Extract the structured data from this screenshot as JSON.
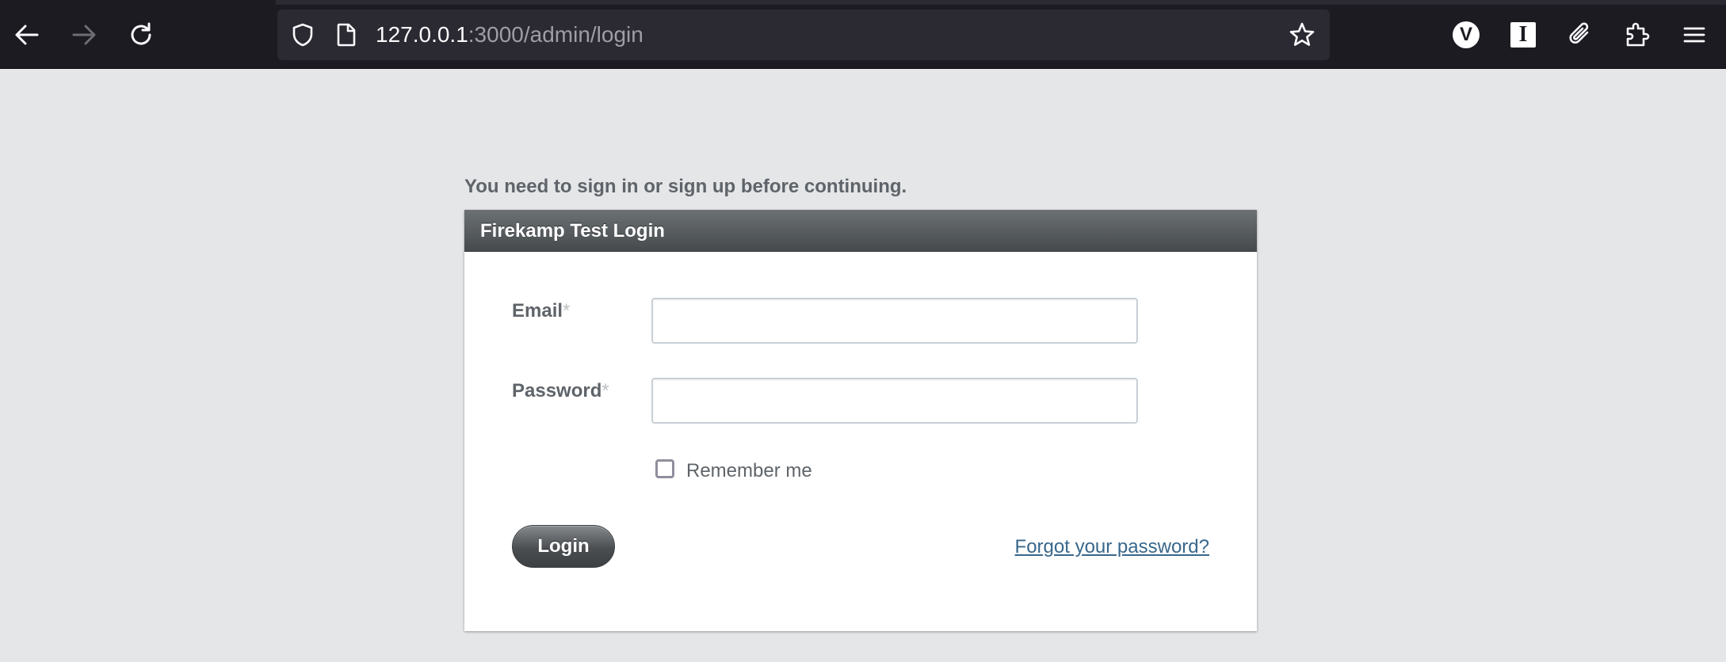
{
  "browser": {
    "url_host": "127.0.0.1",
    "url_path": ":3000/admin/login"
  },
  "notice": {
    "text": "You need to sign in or sign up before continuing."
  },
  "login_panel": {
    "title": "Firekamp Test Login",
    "email_label": "Email",
    "email_required_mark": "*",
    "email_value": "",
    "password_label": "Password",
    "password_required_mark": "*",
    "password_value": "",
    "remember_label": "Remember me",
    "remember_checked": false,
    "login_button": "Login",
    "forgot_link": "Forgot your password?"
  },
  "icons": {
    "back": "back-arrow-icon",
    "forward": "forward-arrow-icon",
    "reload": "reload-icon",
    "tracking": "shield-icon",
    "page": "page-icon",
    "bookmark": "star-icon",
    "extension_v": "V",
    "extension_i": "I",
    "attach": "paperclip-icon",
    "extensions": "puzzle-icon",
    "menu": "hamburger-menu-icon"
  },
  "colors": {
    "page_background": "#e5e6e8",
    "header_dark": "#464a4d",
    "link": "#38678b",
    "label_text": "#5e6469"
  }
}
